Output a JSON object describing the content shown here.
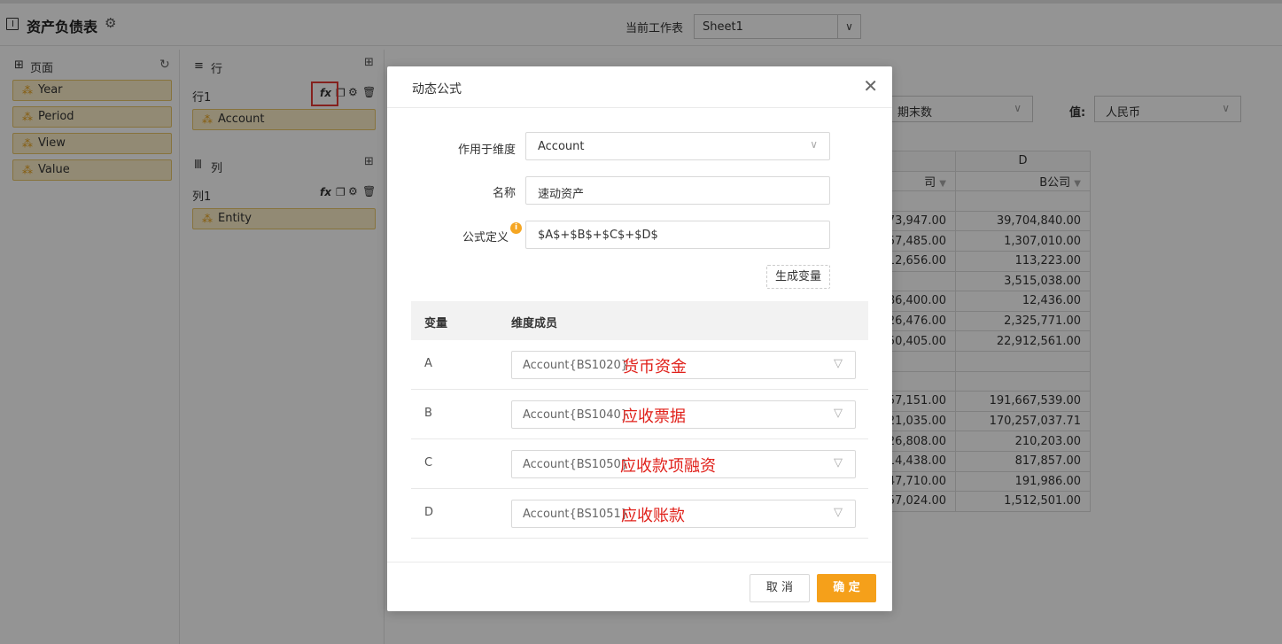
{
  "topbar": {
    "title": "资产负债表",
    "worksheet_label": "当前工作表",
    "worksheet_value": "Sheet1"
  },
  "page_panel": {
    "header": "页面",
    "items": [
      {
        "label": "Year"
      },
      {
        "label": "Period"
      },
      {
        "label": "View"
      },
      {
        "label": "Value"
      }
    ]
  },
  "rows_panel": {
    "header": "行",
    "group_label": "行1",
    "items": [
      {
        "label": "Account"
      }
    ]
  },
  "cols_panel": {
    "header": "列",
    "group_label": "列1",
    "items": [
      {
        "label": "Entity"
      }
    ]
  },
  "grid": {
    "filter1_value": "期末数",
    "value_label": "值:",
    "value_select": "人民币",
    "col_letter_d": "D",
    "col_header_c": "司",
    "col_header_d": "B公司",
    "rows": [
      [
        "",
        ""
      ],
      [
        "73,947.00",
        "39,704,840.00"
      ],
      [
        "57,485.00",
        "1,307,010.00"
      ],
      [
        "12,656.00",
        "113,223.00"
      ],
      [
        "",
        "3,515,038.00"
      ],
      [
        "86,400.00",
        "12,436.00"
      ],
      [
        "26,476.00",
        "2,325,771.00"
      ],
      [
        "50,405.00",
        "22,912,561.00"
      ],
      [
        "",
        ""
      ],
      [
        "",
        ""
      ],
      [
        "57,151.00",
        "191,667,539.00"
      ],
      [
        "21,035.00",
        "170,257,037.71"
      ],
      [
        "26,808.00",
        "210,203.00"
      ],
      [
        "14,438.00",
        "817,857.00"
      ],
      [
        "47,710.00",
        "191,986.00"
      ],
      [
        "57,024.00",
        "1,512,501.00"
      ]
    ]
  },
  "modal": {
    "title": "动态公式",
    "dimension_label": "作用于维度",
    "dimension_value": "Account",
    "name_label": "名称",
    "name_value": "速动资产",
    "formula_label": "公式定义",
    "formula_value": "$A$+$B$+$C$+$D$",
    "generate_button": "生成变量",
    "table_headers": {
      "variable": "变量",
      "member": "维度成员"
    },
    "variables": [
      {
        "name": "A",
        "member": "Account{BS1020}",
        "note": "货币资金"
      },
      {
        "name": "B",
        "member": "Account{BS1040}",
        "note": "应收票据"
      },
      {
        "name": "C",
        "member": "Account{BS1050}",
        "note": "应收款项融资"
      },
      {
        "name": "D",
        "member": "Account{BS1051}",
        "note": "应收账款"
      }
    ],
    "cancel_button": "取 消",
    "ok_button": "确 定"
  },
  "colors": {
    "accent": "#f5a01a",
    "note_red": "#e0201a",
    "highlight_box": "#e53935"
  }
}
